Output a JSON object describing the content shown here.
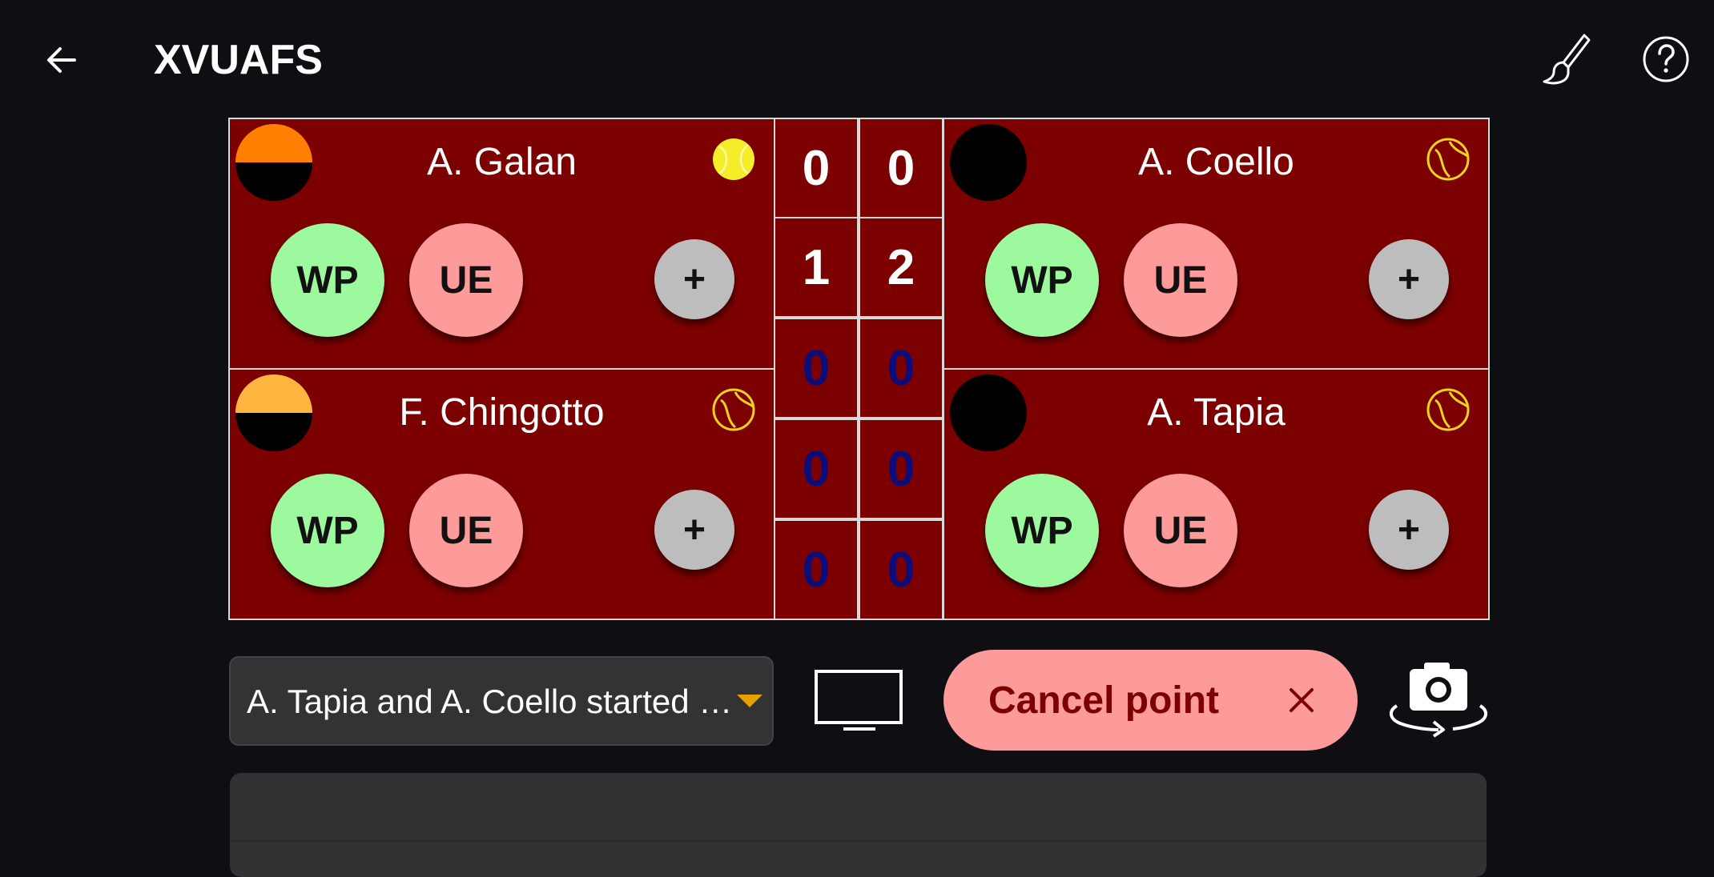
{
  "appbar": {
    "title": "XVUAFS",
    "back_icon": "arrow-left-icon",
    "brush_icon": "paintbrush-icon",
    "help_icon": "help-circle-icon"
  },
  "players": {
    "top_left": {
      "name": "A. Galan",
      "avatar_colors": [
        "#ff7f00",
        "#000000"
      ],
      "serving": true
    },
    "bottom_left": {
      "name": "F. Chingotto",
      "avatar_colors": [
        "#ffb540",
        "#000000"
      ],
      "serving": false
    },
    "top_right": {
      "name": "A. Coello",
      "avatar_colors": [
        "#000000",
        "#000000"
      ],
      "serving": false
    },
    "bottom_right": {
      "name": "A. Tapia",
      "avatar_colors": [
        "#000000",
        "#000000"
      ],
      "serving": false
    }
  },
  "buttons": {
    "wp": "WP",
    "ue": "UE",
    "plus": "+"
  },
  "score": {
    "left": [
      "0",
      "1",
      "0",
      "0",
      "0"
    ],
    "right": [
      "0",
      "2",
      "0",
      "0",
      "0"
    ]
  },
  "log": {
    "selected": "A. Tapia and A. Coello started ser…"
  },
  "actions": {
    "cancel_point": "Cancel point",
    "cancel_icon": "close-icon",
    "tv_icon": "tv-icon",
    "camera_icon": "camera-rotate-icon"
  },
  "colors": {
    "panel": "#7c0000",
    "wp": "#9cf99e",
    "ue": "#fd9a9a",
    "plus": "#bdbdbd",
    "ball_active": "#f5ec2a",
    "ball_outline": "#f2d21b"
  }
}
